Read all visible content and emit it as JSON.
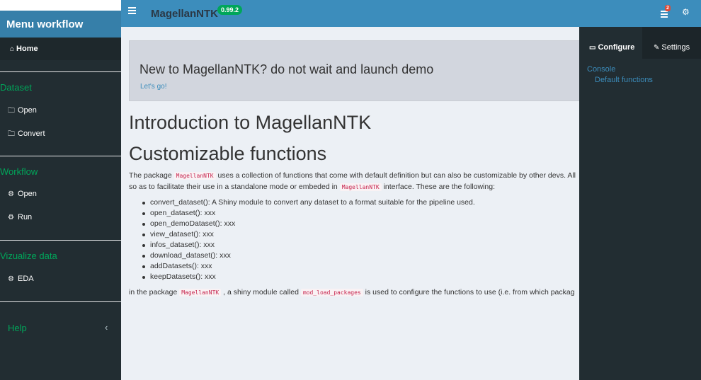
{
  "header": {
    "brand": "Menu workflow",
    "app_title": "MagellanNTK",
    "version": "0.99.2",
    "tasks_badge": "2"
  },
  "sidebar": {
    "home": "Home",
    "sections": [
      {
        "title": "Dataset",
        "items": [
          "Open",
          "Convert"
        ]
      },
      {
        "title": "Workflow",
        "items": [
          "Open",
          "Run"
        ]
      },
      {
        "title": "Vizualize data",
        "items": [
          "EDA"
        ]
      }
    ],
    "help": "Help"
  },
  "main": {
    "jumbo_title": "New to MagellanNTK? do not wait and launch demo",
    "jumbo_link": "Let's go!",
    "h1": "Introduction to MagellanNTK",
    "h2": "Customizable functions",
    "para1_a": "The package ",
    "para1_code": "MagellanNTK",
    "para1_b": " uses a collection of functions that come with default definition but can also be customizable by other devs. All",
    "para2_a": "so as to facilitate their use in a standalone mode or embeded in ",
    "para2_code": "MagellanNTK",
    "para2_b": " interface. These are the following:",
    "functions": [
      "convert_dataset(): A Shiny module to convert any dataset to a format suitable for the pipeline used.",
      "open_dataset(): xxx",
      "open_demoDataset(): xxx",
      "view_dataset(): xxx",
      "infos_dataset(): xxx",
      "download_dataset(): xxx",
      "addDatasets(): xxx",
      "keepDatasets(): xxx"
    ],
    "para3_a": "in the package ",
    "para3_code1": "MagellanNTK",
    "para3_b": " , a shiny module called ",
    "para3_code2": "mod_load_packages",
    "para3_c": " is used to configure the functions to use (i.e. from which packag"
  },
  "control": {
    "tab_configure": "Configure",
    "tab_settings": "Settings",
    "link_console": "Console",
    "link_default": "Default functions"
  },
  "colors": {
    "header": "#3c8dbc",
    "brand": "#367fa9",
    "sidebar": "#222d32",
    "accent_green": "#00a65a",
    "badge_red": "#dd4b39"
  }
}
